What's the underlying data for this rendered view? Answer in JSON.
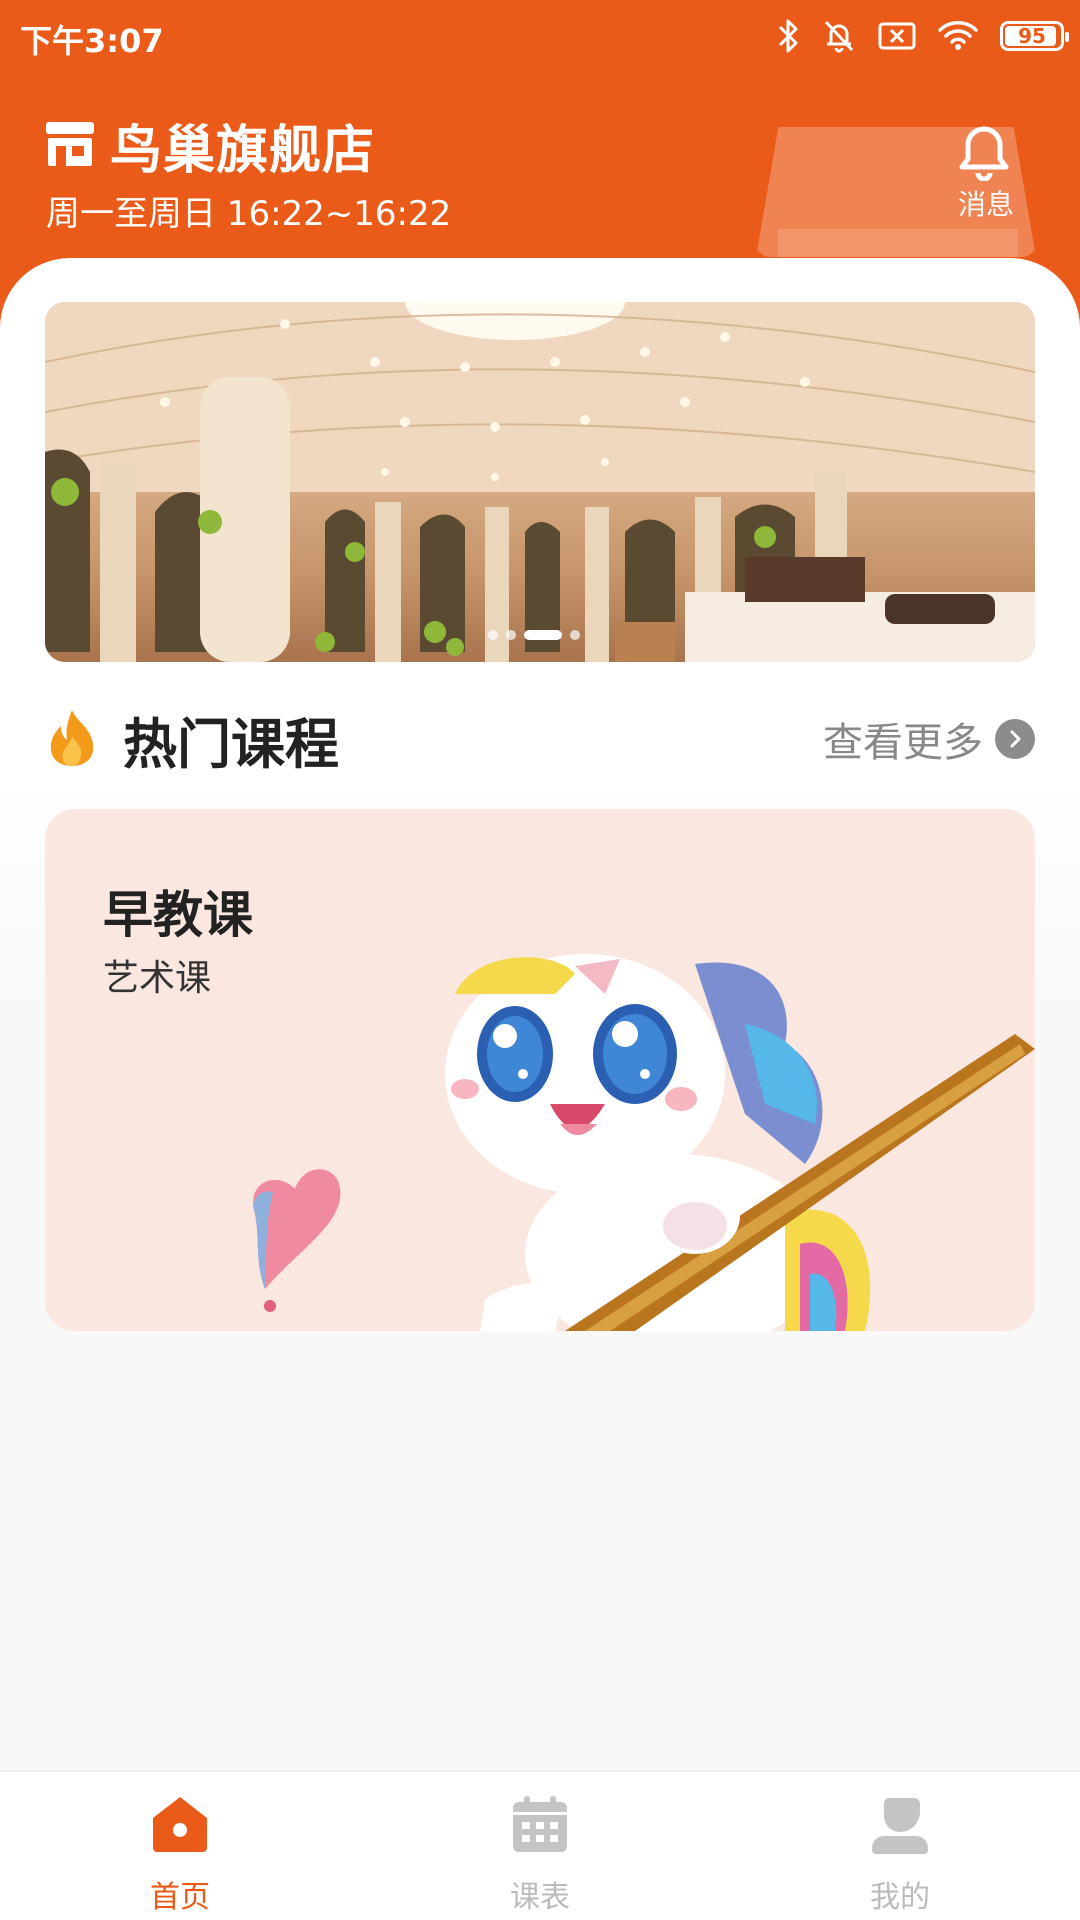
{
  "status_bar": {
    "time": "下午3:07",
    "battery": "95",
    "battery_level_percent": 95,
    "icons": [
      "bluetooth-icon",
      "mute-bell-icon",
      "no-sim-icon",
      "wifi-icon",
      "battery-icon"
    ]
  },
  "header": {
    "store_name": "鸟巢旗舰店",
    "hours": "周一至周日 16:22~16:22",
    "message_label": "消息",
    "store_icon": "store-icon",
    "bell_icon": "bell-icon"
  },
  "banner": {
    "slide_count": 4,
    "active_slide_index": 2
  },
  "hot_courses": {
    "title": "热门课程",
    "more_label": "查看更多",
    "fire_icon": "fire-icon",
    "arrow_icon": "chevron-right-icon"
  },
  "courses": [
    {
      "title": "早教课",
      "subtitle": "艺术课"
    }
  ],
  "bottom_nav": {
    "items": [
      {
        "label": "首页",
        "icon": "home-icon",
        "active": true
      },
      {
        "label": "课表",
        "icon": "calendar-icon",
        "active": false
      },
      {
        "label": "我的",
        "icon": "user-icon",
        "active": false
      }
    ]
  },
  "colors": {
    "brand": "#ea5a19",
    "card_bg": "#fae8e0",
    "inactive_nav": "#bbbbbb"
  }
}
